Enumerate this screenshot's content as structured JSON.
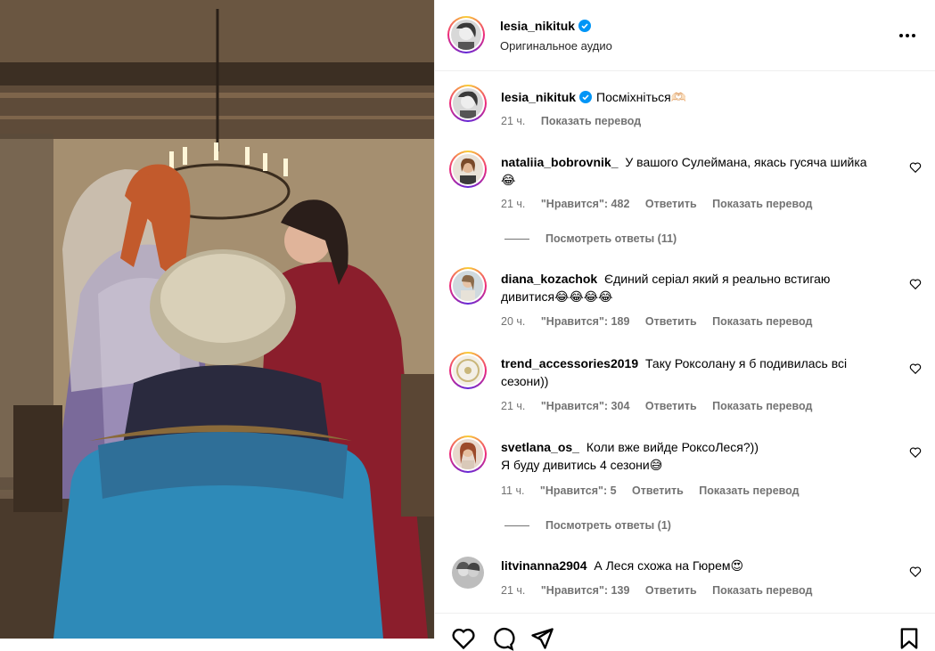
{
  "post": {
    "author": "lesia_nikituk",
    "audio": "Оригинальное аудио",
    "caption_text": "Посміхніться",
    "caption_emoji": "🫶🏻",
    "caption_time": "21 ч.",
    "caption_translate": "Показать перевод"
  },
  "comments": [
    {
      "user": "nataliia_bobrovnik_",
      "text": "У вашого Сулеймана, якась гусяча шийка",
      "emoji": "😂",
      "time": "21 ч.",
      "likes": "\"Нравится\": 482",
      "reply": "Ответить",
      "translate": "Показать перевод",
      "view_replies": "Посмотреть ответы (11)"
    },
    {
      "user": "diana_kozachok",
      "text": "Єдиний серіал який я реально встигаю дивитися",
      "emoji": "😂😂😂😂",
      "time": "20 ч.",
      "likes": "\"Нравится\": 189",
      "reply": "Ответить",
      "translate": "Показать перевод"
    },
    {
      "user": "trend_accessories2019",
      "text": "Таку Роксолану я б подивилась всі сезони))",
      "time": "21 ч.",
      "likes": "\"Нравится\": 304",
      "reply": "Ответить",
      "translate": "Показать перевод"
    },
    {
      "user": "svetlana_os_",
      "text": "Коли вже вийде РоксоЛеся?))",
      "text2": "Я буду дивитись 4 сезони",
      "emoji": "😅",
      "time": "11 ч.",
      "likes": "\"Нравится\": 5",
      "reply": "Ответить",
      "translate": "Показать перевод",
      "view_replies": "Посмотреть ответы (1)"
    },
    {
      "user": "litvinanna2904",
      "text": "А Леся схожа на Гюрем",
      "emoji": "😍",
      "time": "21 ч.",
      "likes": "\"Нравится\": 139",
      "reply": "Ответить",
      "translate": "Показать перевод"
    }
  ],
  "icons": {
    "verified": "verified-badge-icon",
    "more": "more-options-icon",
    "like": "heart-icon",
    "comment": "comment-icon",
    "share": "share-icon",
    "save": "bookmark-icon"
  },
  "colors": {
    "verified": "#0095f6",
    "secondary_text": "#737373",
    "divider": "#efefef"
  }
}
